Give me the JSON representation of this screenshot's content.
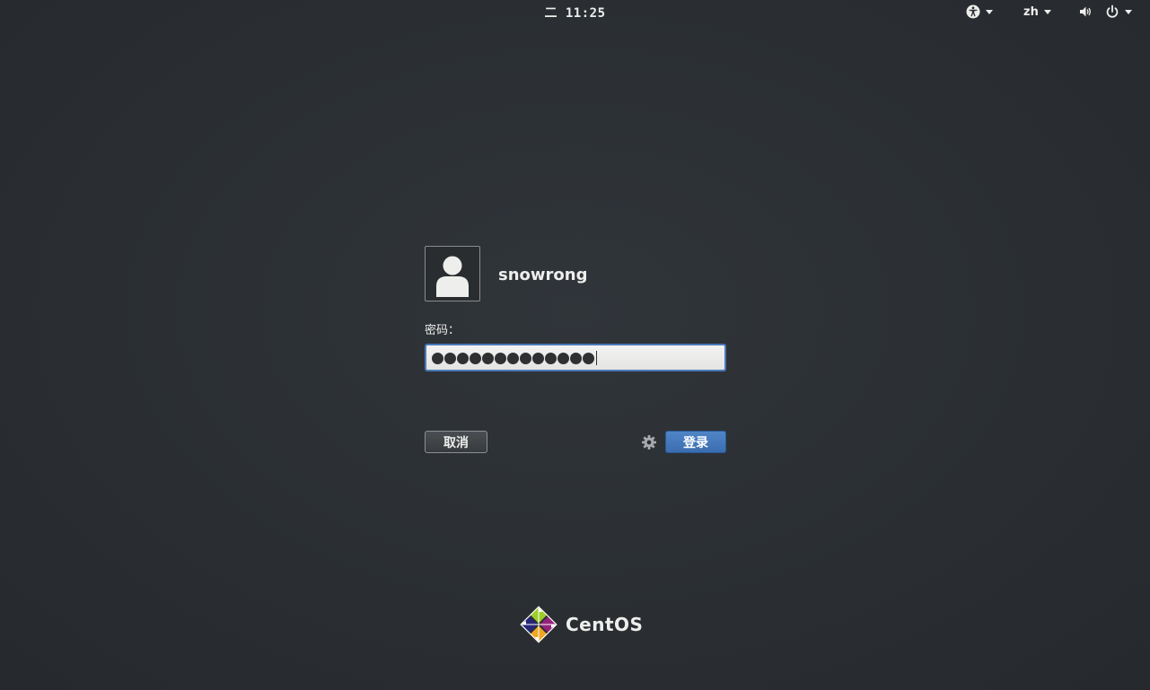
{
  "topbar": {
    "clock": "二 11:25",
    "accessibility_icon": "accessibility-icon",
    "language": "zh",
    "volume_icon": "volume-icon",
    "power_icon": "power-icon"
  },
  "login": {
    "avatar_icon": "user-avatar-icon",
    "username": "snowrong",
    "password_label": "密码：",
    "password_masked_length": 13,
    "cancel_label": "取消",
    "session_icon": "gear-icon",
    "login_label": "登录"
  },
  "branding": {
    "name": "CentOS"
  },
  "colors": {
    "background": "#2b2f33",
    "accent": "#4a7ab8",
    "text": "#eeeeec"
  }
}
